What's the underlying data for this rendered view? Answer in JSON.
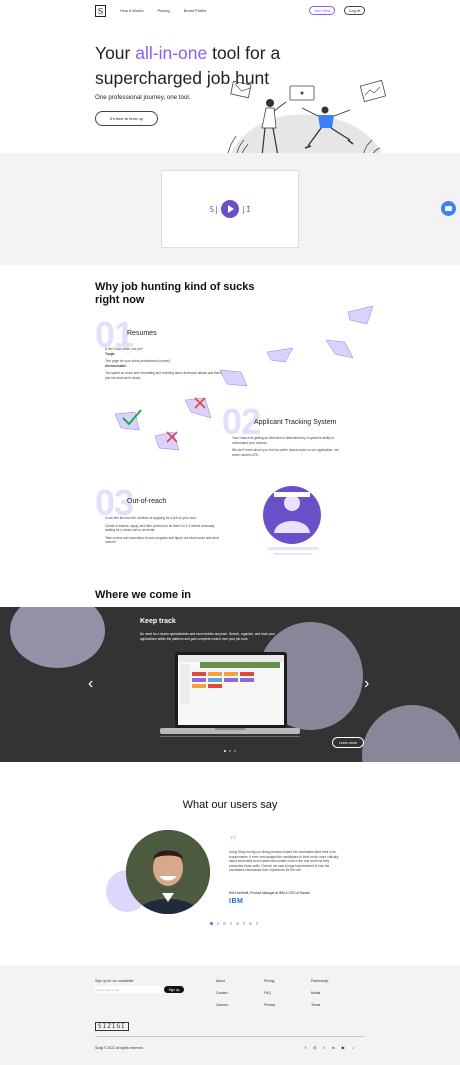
{
  "brand": {
    "logo_letter": "S",
    "wordmark": "SIZIGI",
    "accent": "#8b5cf6",
    "dark_section": "#333333"
  },
  "nav": {
    "links": [
      "How it Works",
      "Pricing",
      "Boost Profile"
    ],
    "join_label": "Join Now",
    "login_label": "Log in"
  },
  "hero": {
    "line1_pre": "Your ",
    "line1_accent": "all-in-one",
    "line1_post": " tool for a",
    "line2": "supercharged job hunt",
    "tagline": "One professional journey, one tool.",
    "cta_label": "It's time to level up"
  },
  "video": {
    "logo_left": "S|",
    "logo_right": "|I"
  },
  "why": {
    "title": "Why job hunting kind of sucks right now",
    "items": [
      {
        "num": "01",
        "title": "Resumes",
        "lines": [
          "A 'fee' build within one job?",
          "Tough.",
          "One page for your entire professional journey?",
          "Unreasonable.",
          "You spend so much time formatting and rewriting about irrelevant details and that's just not what we're about."
        ]
      },
      {
        "num": "02",
        "title": "Applicant Tracking System",
        "lines": [
          "Your chance at getting an interview is determined by a system's ability to understand your resume.",
          "We don't know about you, but we prefer human eyes on our application, not some random ATS."
        ]
      },
      {
        "num": "03",
        "title": "Out-of-reach",
        "lines": [
          "It can feel far from the confines of applying for a job on your own.",
          "Create a resume, apply, and then proceed to sit there for 2-3 weeks anxiously waiting for a phone call or an email.",
          "Take control and ownership of your progress and figure out what works and what doesn't!"
        ]
      }
    ]
  },
  "where": {
    "title": "Where we come in",
    "slide_title": "Keep track",
    "slide_text": "No need for a dozen spreadsheets and excel entries anymore. Search, organize, and track your applications within the platform and gain complete control over your job hunt.",
    "learn_more": "Learn more",
    "prev_arrow": "‹",
    "next_arrow": "›"
  },
  "testimonials": {
    "title": "What our users say",
    "quote_mark": "“",
    "quote": "Using Sizigi during our hiring process helped the candidates tailor their core requirements. It even encouraged the candidates to think much more critically about what skills and experiences matter most in the role and how they presented those skills. Overall, we saw a huge improvement in how the candidates showcased their experience for the role.",
    "author": "Erik Hornfeldt, Product Manager at IBM & CEO of Sizzlex",
    "company": "IBM"
  },
  "footer": {
    "newsletter_label": "Sign up for our newsletter",
    "email_placeholder": "Enter your email",
    "signup_label": "Sign up",
    "col1": [
      "About",
      "Contact",
      "Careers"
    ],
    "col2": [
      "Pricing",
      "FAQ",
      "Privacy"
    ],
    "col3": [
      "Partnership",
      "Media",
      "Terms"
    ],
    "copyright": "Sizigi © 2021 all rights reserved",
    "social": [
      "f",
      "◎",
      "t",
      "in",
      "▶",
      "♪"
    ]
  }
}
